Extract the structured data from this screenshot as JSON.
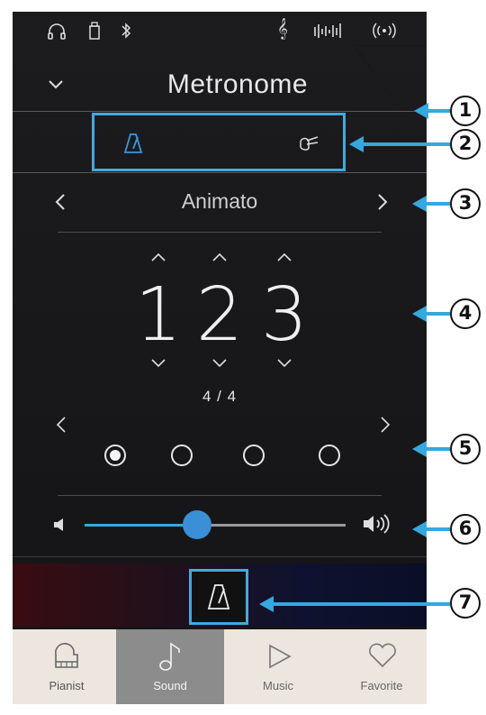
{
  "status_bar": {
    "icons": [
      "headphones-icon",
      "usb-memory-icon",
      "bluetooth-icon",
      "treble-clef-icon",
      "equalizer-icon",
      "wireless-icon"
    ]
  },
  "header": {
    "title": "Metronome"
  },
  "mode_switch": {
    "active": "metronome",
    "options": [
      "metronome-icon",
      "rhythm-hand-icon"
    ]
  },
  "tempo_name": {
    "label": "Animato"
  },
  "tempo": {
    "digits": [
      "1",
      "2",
      "3"
    ]
  },
  "time_signature": {
    "label": "4 / 4"
  },
  "beats": {
    "total": 4,
    "active_index": 0
  },
  "volume": {
    "level": 0.43
  },
  "callouts": [
    "1",
    "2",
    "3",
    "4",
    "5",
    "6",
    "7"
  ],
  "bottom_tabs": [
    {
      "label": "Pianist",
      "icon": "piano-icon"
    },
    {
      "label": "Sound",
      "icon": "music-note-icon",
      "active": true
    },
    {
      "label": "Music",
      "icon": "play-icon"
    },
    {
      "label": "Favorite",
      "icon": "heart-icon"
    }
  ],
  "colors": {
    "accent": "#35a8df",
    "highlight": "#46a8dc",
    "slider_knob": "#3b8fd6"
  }
}
